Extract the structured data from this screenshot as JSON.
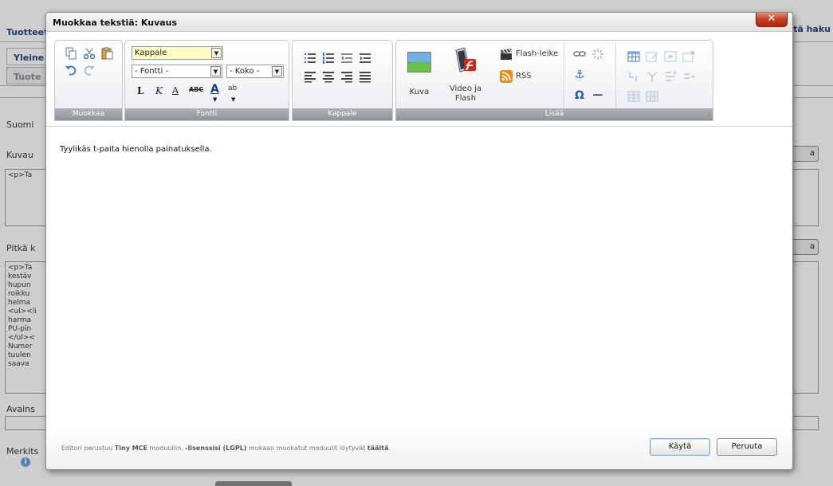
{
  "background": {
    "title": "Tuotteet",
    "right_link": "tä haku",
    "tabs": [
      "Yleine",
      "Tuote"
    ],
    "label_language": "Suomi",
    "label_kuvaus": "Kuvau",
    "kuvaus_box": "<p>Ta",
    "label_pitka": "Pitkä k",
    "pitka_lines": [
      "<p>Ta",
      "kestäv",
      "hupun",
      "roikku",
      "helma",
      "<ul><li",
      "harma",
      "PU-pin",
      "</ul><",
      "Numer",
      "tuulen",
      "saava"
    ],
    "label_avains": "Avains",
    "label_merkits": "Merkits",
    "right_btn": "a",
    "info_glyph": "i"
  },
  "dialog": {
    "title": "Muokkaa tekstiä: Kuvaus",
    "close_label": "✕"
  },
  "toolbar": {
    "groups": {
      "edit": "Muokkaa",
      "font": "Fontti",
      "paragraph": "Kappale",
      "insert": "Lisää"
    },
    "format_select": "Kappale",
    "font_select": "- Fontti -",
    "size_select": "- Koko -",
    "bold": "L",
    "italic": "K",
    "underline": "A",
    "strike": "ABC",
    "fontcolor": "A",
    "highlight": "ab",
    "image_label": "Kuva",
    "video_label_1": "Video ja",
    "video_label_2": "Flash",
    "flash_clip_label": "Flash-leike",
    "rss_label": "RSS",
    "omega": "Ω",
    "hr": "—",
    "anchor": "⚓",
    "dropdown_arrow": "▼"
  },
  "editor": {
    "content": "Tyylikäs t-paita hienolla painatuksella."
  },
  "footer": {
    "note_1": "Editori perustuu",
    "note_tiny": "Tiny MCE",
    "note_2": "moduuliin.",
    "note_license": "-lisenssisi (LGPL)",
    "note_3": "mukaan muokatut moduulit löytyvät",
    "note_link": "täältä",
    "note_end": ".",
    "apply_label": "Käytä",
    "cancel_label": "Peruuta"
  },
  "colors": {
    "dialog_bg": "#ffffff",
    "close_red": "#c43b20",
    "toolbar_label_bg": "#9a9ea5",
    "link_blue": "#1d3e7a"
  }
}
